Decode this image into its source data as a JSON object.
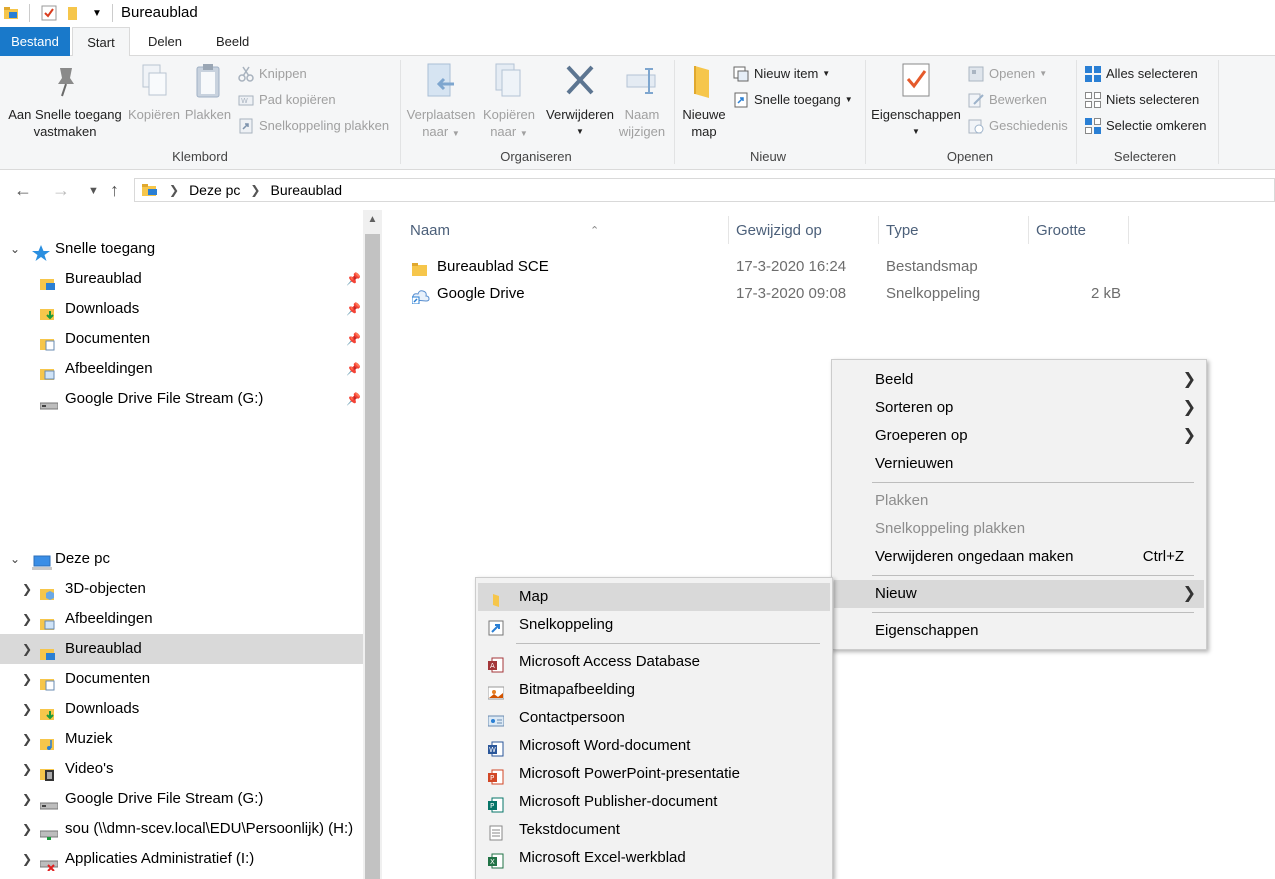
{
  "window": {
    "title": "Bureaublad"
  },
  "tabs": [
    {
      "label": "Bestand"
    },
    {
      "label": "Start"
    },
    {
      "label": "Delen"
    },
    {
      "label": "Beeld"
    }
  ],
  "ribbon": {
    "klembord": {
      "label": "Klembord",
      "pin_line1": "Aan Snelle toegang",
      "pin_line2": "vastmaken",
      "copy": "Kopiëren",
      "paste": "Plakken",
      "cut": "Knippen",
      "copy_path": "Pad kopiëren",
      "paste_shortcut": "Snelkoppeling plakken"
    },
    "organiseren": {
      "label": "Organiseren",
      "move_line1": "Verplaatsen",
      "move_line2": "naar",
      "copyto_line1": "Kopiëren",
      "copyto_line2": "naar",
      "delete": "Verwijderen",
      "rename_line1": "Naam",
      "rename_line2": "wijzigen"
    },
    "nieuw": {
      "label": "Nieuw",
      "newfolder_line1": "Nieuwe",
      "newfolder_line2": "map",
      "new_item": "Nieuw item",
      "easy_access": "Snelle toegang"
    },
    "openen": {
      "label": "Openen",
      "properties": "Eigenschappen",
      "open": "Openen",
      "edit": "Bewerken",
      "history": "Geschiedenis"
    },
    "selecteren": {
      "label": "Selecteren",
      "select_all": "Alles selecteren",
      "select_none": "Niets selecteren",
      "invert": "Selectie omkeren"
    }
  },
  "address": {
    "crumbs": [
      "Deze pc",
      "Bureaublad"
    ]
  },
  "sidebar": {
    "quick_access": "Snelle toegang",
    "quick_items": [
      {
        "label": "Bureaublad"
      },
      {
        "label": "Downloads"
      },
      {
        "label": "Documenten"
      },
      {
        "label": "Afbeeldingen"
      },
      {
        "label": "Google Drive File Stream (G:)"
      }
    ],
    "this_pc": "Deze pc",
    "pc_items": [
      {
        "label": "3D-objecten"
      },
      {
        "label": "Afbeeldingen"
      },
      {
        "label": "Bureaublad"
      },
      {
        "label": "Documenten"
      },
      {
        "label": "Downloads"
      },
      {
        "label": "Muziek"
      },
      {
        "label": "Video's"
      },
      {
        "label": "Google Drive File Stream (G:)"
      },
      {
        "label": "sou (\\\\dmn-scev.local\\EDU\\Persoonlijk) (H:)"
      },
      {
        "label": "Applicaties Administratief (I:)"
      }
    ]
  },
  "filelist": {
    "columns": [
      "Naam",
      "Gewijzigd op",
      "Type",
      "Grootte"
    ],
    "rows": [
      {
        "name": "Bureaublad SCE",
        "date": "17-3-2020 16:24",
        "type": "Bestandsmap",
        "size": ""
      },
      {
        "name": "Google Drive",
        "date": "17-3-2020 09:08",
        "type": "Snelkoppeling",
        "size": "2 kB"
      }
    ]
  },
  "context_menu": {
    "items": [
      {
        "label": "Beeld"
      },
      {
        "label": "Sorteren op"
      },
      {
        "label": "Groeperen op"
      },
      {
        "label": "Vernieuwen"
      },
      {
        "label": "Plakken"
      },
      {
        "label": "Snelkoppeling plakken"
      },
      {
        "label": "Verwijderen ongedaan maken",
        "shortcut": "Ctrl+Z"
      },
      {
        "label": "Nieuw"
      },
      {
        "label": "Eigenschappen"
      }
    ]
  },
  "submenu_new": {
    "items": [
      {
        "label": "Map"
      },
      {
        "label": "Snelkoppeling"
      },
      {
        "label": "Microsoft Access Database"
      },
      {
        "label": "Bitmapafbeelding"
      },
      {
        "label": "Contactpersoon"
      },
      {
        "label": "Microsoft Word-document"
      },
      {
        "label": "Microsoft PowerPoint-presentatie"
      },
      {
        "label": "Microsoft Publisher-document"
      },
      {
        "label": "Tekstdocument"
      },
      {
        "label": "Microsoft Excel-werkblad"
      }
    ]
  }
}
